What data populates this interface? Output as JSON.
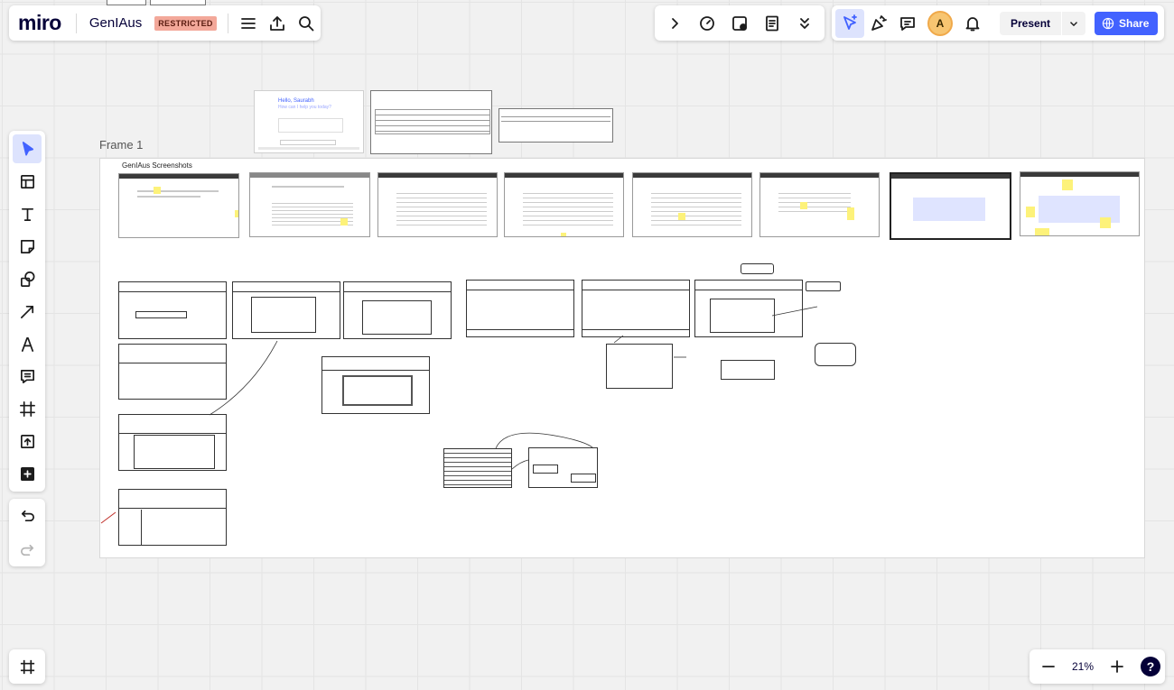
{
  "topbar": {
    "logo": "miro",
    "board_name": "GenIAus",
    "badge": "RESTRICTED"
  },
  "collab": {
    "avatar_initial": "A",
    "present_label": "Present",
    "share_label": "Share"
  },
  "canvas": {
    "frame_label": "Frame 1",
    "screenshots_title": "GenIAus Screenshots",
    "hello_card_title": "Hello, Saurabh",
    "hello_card_sub": "How can I help you today?"
  },
  "zoom": {
    "level": "21%",
    "help": "?"
  },
  "colors": {
    "accent": "#4262ff",
    "accent_bg": "#dde3fd",
    "badge": "#f3a89a",
    "sticky": "#fdf27a"
  }
}
